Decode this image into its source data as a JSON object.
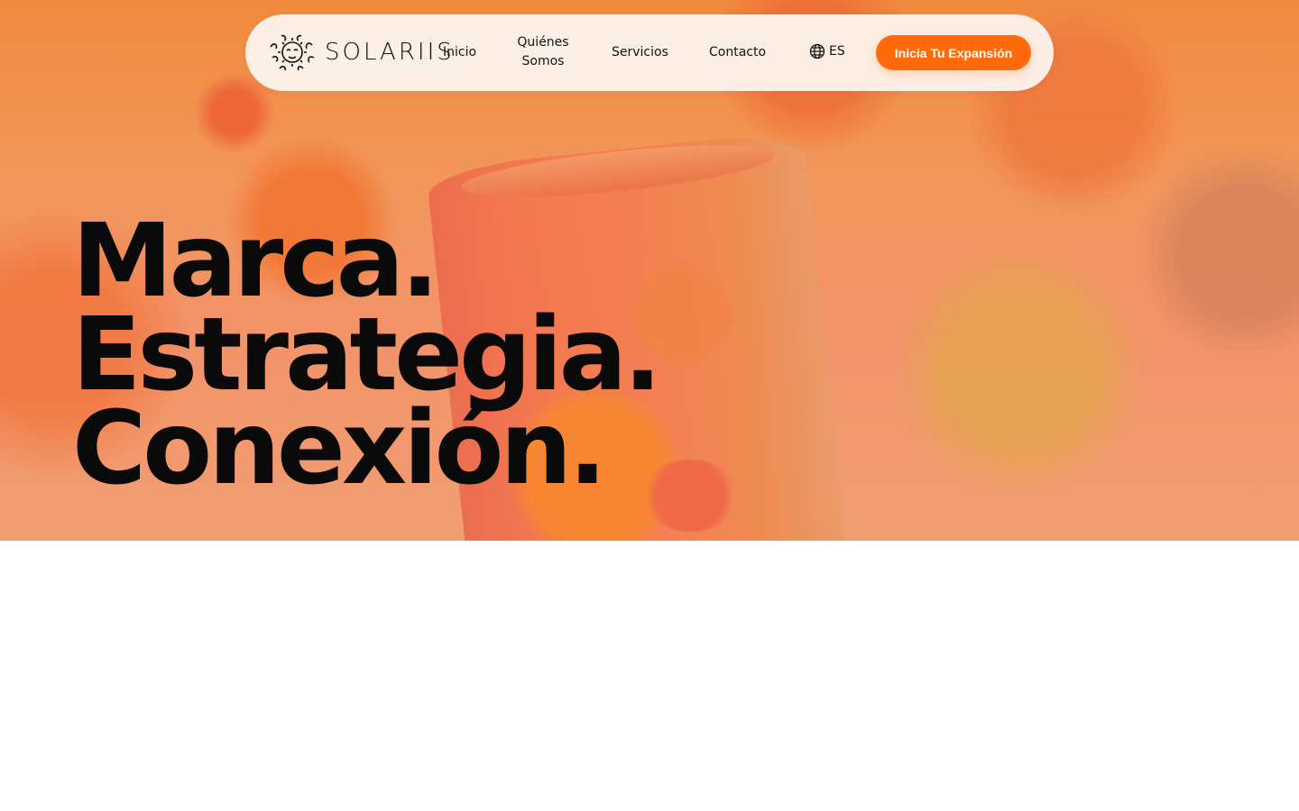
{
  "brand": {
    "name": "SOLARIIS"
  },
  "nav": {
    "items": [
      {
        "label": "Inicio"
      },
      {
        "label": "Quiénes Somos"
      },
      {
        "label": "Servicios"
      },
      {
        "label": "Contacto"
      }
    ],
    "language": "ES",
    "cta": "Inicia Tu Expansión"
  },
  "hero": {
    "lines": [
      "Marca.",
      "Estrategia.",
      "Conexión."
    ]
  },
  "colors": {
    "accent": "#ff6b0a",
    "text": "#0a0a0a",
    "nav_bg": "#fcf2ec",
    "hero_tint": "#f29570"
  }
}
